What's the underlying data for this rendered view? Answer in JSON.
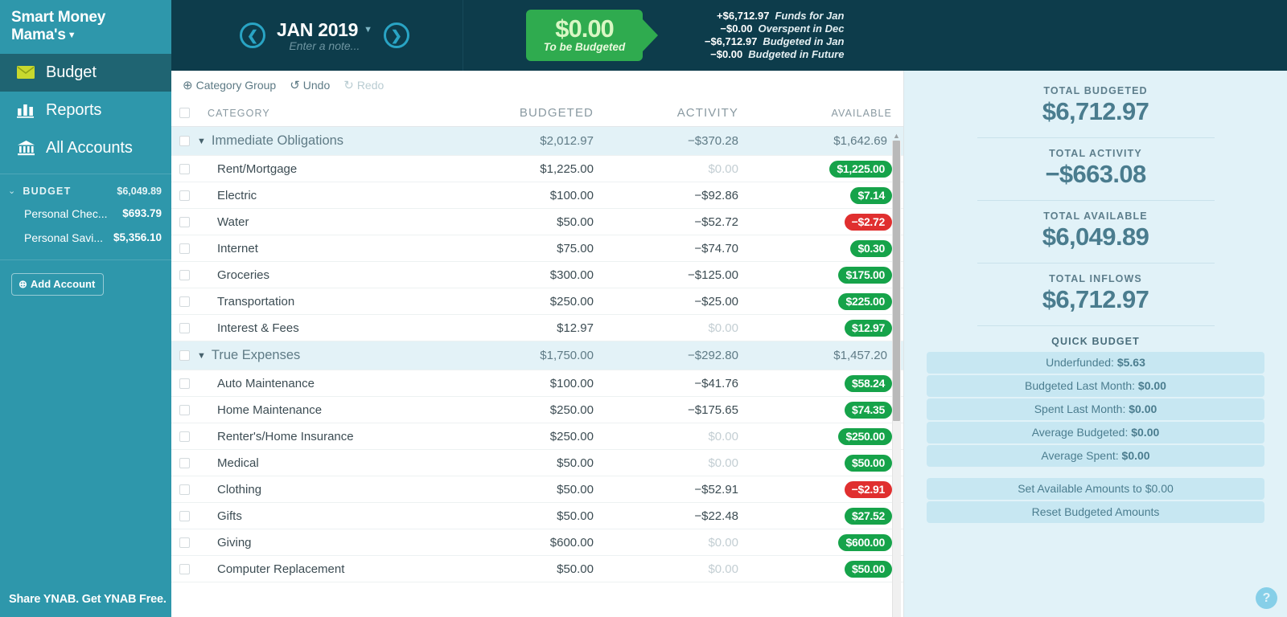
{
  "sidebar": {
    "brand": "Smart Money Mama's",
    "nav": [
      {
        "label": "Budget",
        "icon": "envelope-icon",
        "active": true
      },
      {
        "label": "Reports",
        "icon": "bar-chart-icon",
        "active": false
      },
      {
        "label": "All Accounts",
        "icon": "bank-icon",
        "active": false
      }
    ],
    "accounts_header": {
      "label": "BUDGET",
      "amount": "$6,049.89"
    },
    "accounts": [
      {
        "name": "Personal Chec...",
        "amount": "$693.79"
      },
      {
        "name": "Personal Savi...",
        "amount": "$5,356.10"
      }
    ],
    "add_account_label": "Add Account",
    "footer": "Share YNAB. Get YNAB Free."
  },
  "header": {
    "prev_icon": "chevron-left-icon",
    "next_icon": "chevron-right-icon",
    "month": "JAN 2019",
    "note_placeholder": "Enter a note...",
    "to_be_budgeted": {
      "amount": "$0.00",
      "label": "To be Budgeted"
    },
    "breakdown": [
      {
        "amount": "+$6,712.97",
        "label": "Funds for Jan"
      },
      {
        "amount": "−$0.00",
        "label": "Overspent in Dec"
      },
      {
        "amount": "−$6,712.97",
        "label": "Budgeted in Jan"
      },
      {
        "amount": "−$0.00",
        "label": "Budgeted in Future"
      }
    ]
  },
  "toolbar": {
    "category_group": "Category Group",
    "undo": "Undo",
    "redo": "Redo"
  },
  "table": {
    "columns": [
      "CATEGORY",
      "BUDGETED",
      "ACTIVITY",
      "AVAILABLE"
    ],
    "rows": [
      {
        "type": "group",
        "name": "Immediate Obligations",
        "budgeted": "$2,012.97",
        "activity": "−$370.28",
        "available": "$1,642.69"
      },
      {
        "type": "item",
        "name": "Rent/Mortgage",
        "budgeted": "$1,225.00",
        "activity": "$0.00",
        "activity_zero": true,
        "available": "$1,225.00",
        "available_state": "positive"
      },
      {
        "type": "item",
        "name": "Electric",
        "budgeted": "$100.00",
        "activity": "−$92.86",
        "activity_zero": false,
        "available": "$7.14",
        "available_state": "positive"
      },
      {
        "type": "item",
        "name": "Water",
        "budgeted": "$50.00",
        "activity": "−$52.72",
        "activity_zero": false,
        "available": "−$2.72",
        "available_state": "negative"
      },
      {
        "type": "item",
        "name": "Internet",
        "budgeted": "$75.00",
        "activity": "−$74.70",
        "activity_zero": false,
        "available": "$0.30",
        "available_state": "positive"
      },
      {
        "type": "item",
        "name": "Groceries",
        "budgeted": "$300.00",
        "activity": "−$125.00",
        "activity_zero": false,
        "available": "$175.00",
        "available_state": "positive"
      },
      {
        "type": "item",
        "name": "Transportation",
        "budgeted": "$250.00",
        "activity": "−$25.00",
        "activity_zero": false,
        "available": "$225.00",
        "available_state": "positive"
      },
      {
        "type": "item",
        "name": "Interest & Fees",
        "budgeted": "$12.97",
        "activity": "$0.00",
        "activity_zero": true,
        "available": "$12.97",
        "available_state": "positive"
      },
      {
        "type": "group",
        "name": "True Expenses",
        "budgeted": "$1,750.00",
        "activity": "−$292.80",
        "available": "$1,457.20"
      },
      {
        "type": "item",
        "name": "Auto Maintenance",
        "budgeted": "$100.00",
        "activity": "−$41.76",
        "activity_zero": false,
        "available": "$58.24",
        "available_state": "positive"
      },
      {
        "type": "item",
        "name": "Home Maintenance",
        "budgeted": "$250.00",
        "activity": "−$175.65",
        "activity_zero": false,
        "available": "$74.35",
        "available_state": "positive"
      },
      {
        "type": "item",
        "name": "Renter's/Home Insurance",
        "budgeted": "$250.00",
        "activity": "$0.00",
        "activity_zero": true,
        "available": "$250.00",
        "available_state": "positive"
      },
      {
        "type": "item",
        "name": "Medical",
        "budgeted": "$50.00",
        "activity": "$0.00",
        "activity_zero": true,
        "available": "$50.00",
        "available_state": "positive"
      },
      {
        "type": "item",
        "name": "Clothing",
        "budgeted": "$50.00",
        "activity": "−$52.91",
        "activity_zero": false,
        "available": "−$2.91",
        "available_state": "negative"
      },
      {
        "type": "item",
        "name": "Gifts",
        "budgeted": "$50.00",
        "activity": "−$22.48",
        "activity_zero": false,
        "available": "$27.52",
        "available_state": "positive"
      },
      {
        "type": "item",
        "name": "Giving",
        "budgeted": "$600.00",
        "activity": "$0.00",
        "activity_zero": true,
        "available": "$600.00",
        "available_state": "positive"
      },
      {
        "type": "item",
        "name": "Computer Replacement",
        "budgeted": "$50.00",
        "activity": "$0.00",
        "activity_zero": true,
        "available": "$50.00",
        "available_state": "positive"
      }
    ]
  },
  "inspector": {
    "stats": [
      {
        "label": "TOTAL BUDGETED",
        "value": "$6,712.97"
      },
      {
        "label": "TOTAL ACTIVITY",
        "value": "−$663.08"
      },
      {
        "label": "TOTAL AVAILABLE",
        "value": "$6,049.89"
      },
      {
        "label": "TOTAL INFLOWS",
        "value": "$6,712.97"
      }
    ],
    "quick_budget_title": "QUICK BUDGET",
    "quick_budget": [
      {
        "label": "Underfunded: ",
        "value": "$5.63"
      },
      {
        "label": "Budgeted Last Month: ",
        "value": "$0.00"
      },
      {
        "label": "Spent Last Month: ",
        "value": "$0.00"
      },
      {
        "label": "Average Budgeted: ",
        "value": "$0.00"
      },
      {
        "label": "Average Spent: ",
        "value": "$0.00"
      }
    ],
    "actions": [
      {
        "label": "Set Available Amounts to $0.00"
      },
      {
        "label": "Reset Budgeted Amounts"
      }
    ],
    "help_icon": "question-mark-icon"
  },
  "colors": {
    "sidebar": "#2e97ab",
    "sidebar_active": "#1f6472",
    "topbar": "#0d3c4b",
    "green": "#2fab4f",
    "pill_green": "#16a34a",
    "pill_red": "#e02f2f",
    "inspector_bg": "#e1f2f8"
  }
}
